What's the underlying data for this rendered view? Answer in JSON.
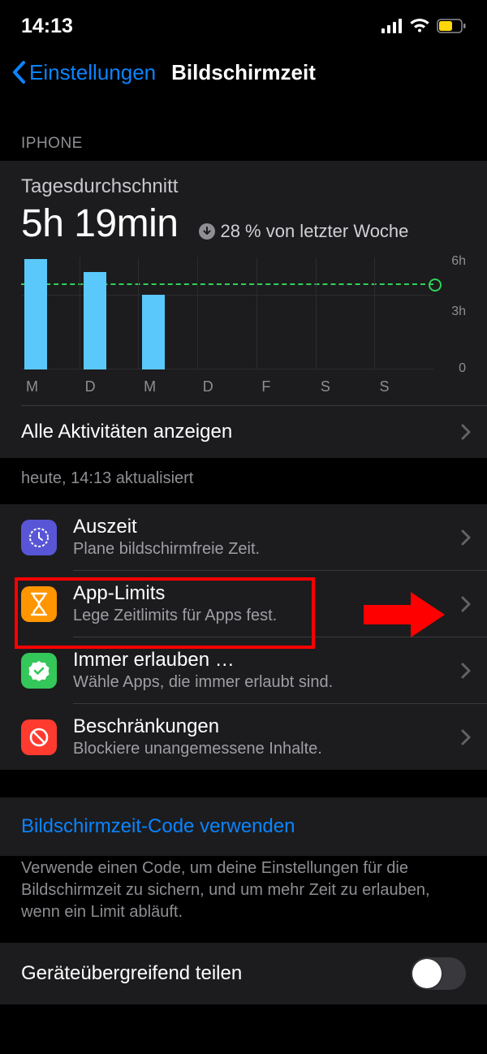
{
  "status": {
    "time": "14:13"
  },
  "nav": {
    "back": "Einstellungen",
    "title": "Bildschirmzeit"
  },
  "section_header": "IPHONE",
  "summary": {
    "avg_label": "Tagesdurchschnitt",
    "avg_value": "5h 19min",
    "delta_text": "28 % von letzter Woche"
  },
  "chart_data": {
    "type": "bar",
    "categories": [
      "M",
      "D",
      "M",
      "D",
      "F",
      "S",
      "S"
    ],
    "values": [
      5.9,
      5.2,
      4.0,
      0,
      0,
      0,
      0
    ],
    "average_line": 5.3,
    "ylim": [
      0,
      6
    ],
    "yticks": [
      0,
      3,
      6
    ],
    "ytick_labels": [
      "0",
      "3h",
      "6h"
    ]
  },
  "all_activities": "Alle Aktivitäten anzeigen",
  "timestamp": "heute, 14:13 aktualisiert",
  "items": [
    {
      "icon": "clock",
      "color": "#5856d6",
      "title": "Auszeit",
      "subtitle": "Plane bildschirmfreie Zeit."
    },
    {
      "icon": "hourglass",
      "color": "#ff9500",
      "title": "App-Limits",
      "subtitle": "Lege Zeitlimits für Apps fest."
    },
    {
      "icon": "check",
      "color": "#34c759",
      "title": "Immer erlauben …",
      "subtitle": "Wähle Apps, die immer erlaubt sind."
    },
    {
      "icon": "nosign",
      "color": "#ff3b30",
      "title": "Beschränkungen",
      "subtitle": "Blockiere unangemessene Inhalte."
    }
  ],
  "code": {
    "link": "Bildschirmzeit-Code verwenden",
    "footer": "Verwende einen Code, um deine Einstellungen für die Bildschirmzeit zu sichern, und um mehr Zeit zu erlauben, wenn ein Limit abläuft."
  },
  "share": {
    "label": "Geräteübergreifend teilen",
    "on": false
  }
}
